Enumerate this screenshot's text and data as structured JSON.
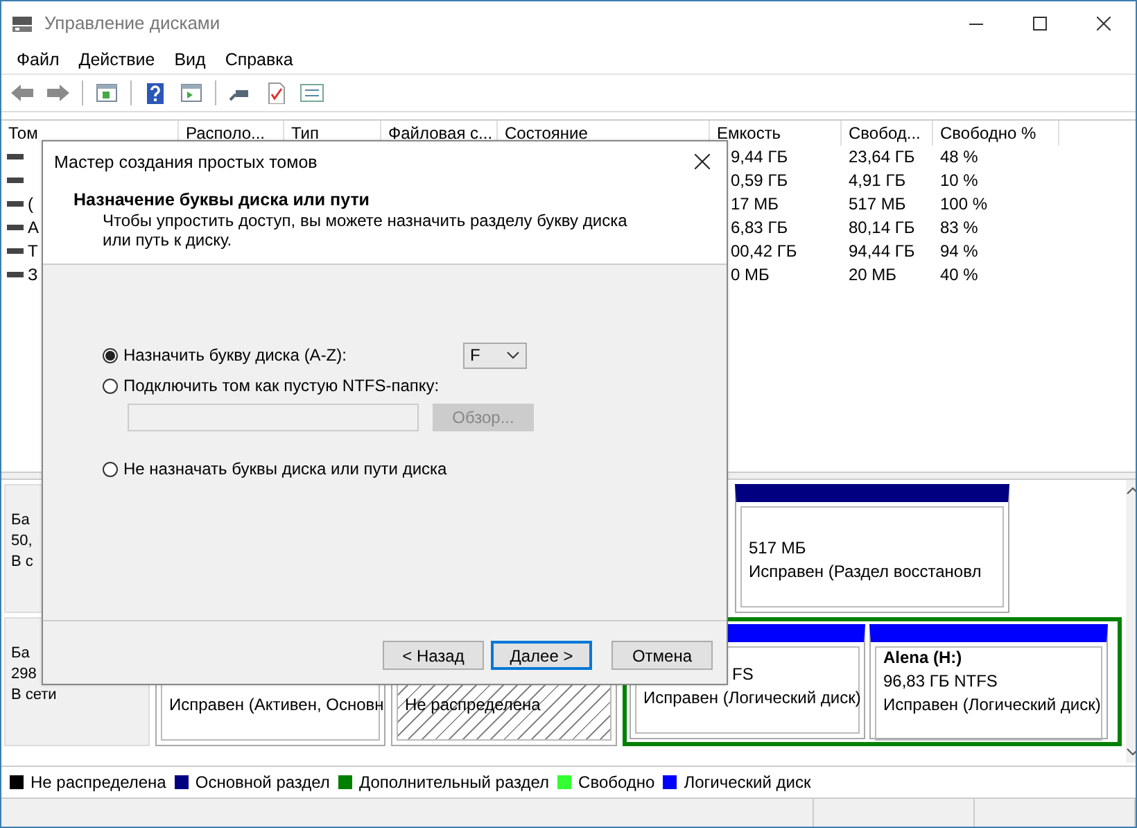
{
  "window": {
    "title": "Управление дисками"
  },
  "menu": [
    "Файл",
    "Действие",
    "Вид",
    "Справка"
  ],
  "volume_table": {
    "columns": [
      "Том",
      "Располо...",
      "Тип",
      "Файловая с...",
      "Состояние",
      "Емкость",
      "Свобод...",
      "Свободно %"
    ],
    "rows": [
      {
        "capacity": "9,44 ГБ",
        "free": "23,64 ГБ",
        "free_percent": "48 %"
      },
      {
        "capacity": "0,59 ГБ",
        "free": "4,91 ГБ",
        "free_percent": "10 %"
      },
      {
        "volume": "(",
        "capacity": "17 МБ",
        "free": "517 МБ",
        "free_percent": "100 %"
      },
      {
        "volume": "А",
        "capacity": "6,83 ГБ",
        "free": "80,14 ГБ",
        "free_percent": "83 %"
      },
      {
        "volume": "Т",
        "capacity": "00,42 ГБ",
        "free": "94,44 ГБ",
        "free_percent": "94 %"
      },
      {
        "volume": "З",
        "capacity": "0 МБ",
        "free": "20 МБ",
        "free_percent": "40 %"
      }
    ]
  },
  "disks": [
    {
      "label_lines": [
        "Ба",
        "50,",
        "В с"
      ],
      "partitions": [
        {
          "kind": "primary",
          "lines": [
            "517 МБ",
            "Исправен (Раздел восстановл"
          ]
        }
      ]
    },
    {
      "label_lines": [
        "Ба",
        "298",
        "В сети"
      ],
      "partitions": [
        {
          "kind": "primary",
          "lines": [
            "Исправен (Активен, Основн"
          ]
        },
        {
          "kind": "unallocated",
          "lines": [
            "Не распределена"
          ]
        },
        {
          "kind": "extended",
          "children": [
            {
              "kind": "logical",
              "lines": [
                "FS",
                "Исправен (Логический диск)"
              ]
            },
            {
              "kind": "logical",
              "title": "Alena  (H:)",
              "lines": [
                "96,83 ГБ NTFS",
                "Исправен (Логический диск)"
              ]
            }
          ]
        }
      ]
    }
  ],
  "legend": [
    {
      "label": "Не распределена",
      "color": "#000000"
    },
    {
      "label": "Основной раздел",
      "color": "#000080"
    },
    {
      "label": "Дополнительный раздел",
      "color": "#008000"
    },
    {
      "label": "Свободно",
      "color": "#33ff33"
    },
    {
      "label": "Логический диск",
      "color": "#0000ff"
    }
  ],
  "dialog": {
    "title": "Мастер создания простых томов",
    "heading": "Назначение буквы диска или пути",
    "description": "Чтобы упростить доступ, вы можете назначить разделу букву диска или путь к диску.",
    "options": [
      {
        "kind": "letter",
        "label": "Назначить букву диска (A-Z):",
        "selected": true,
        "value": "F"
      },
      {
        "kind": "folder",
        "label": "Подключить том как пустую NTFS-папку:",
        "selected": false,
        "disabled": true,
        "browse": "Обзор..."
      },
      {
        "kind": "none",
        "label": "Не назначать буквы диска или пути диска",
        "selected": false
      }
    ],
    "buttons": [
      {
        "label": "< Назад",
        "default": false
      },
      {
        "label": "Далее >",
        "default": true
      },
      {
        "label": "Отмена",
        "default": false
      }
    ]
  }
}
